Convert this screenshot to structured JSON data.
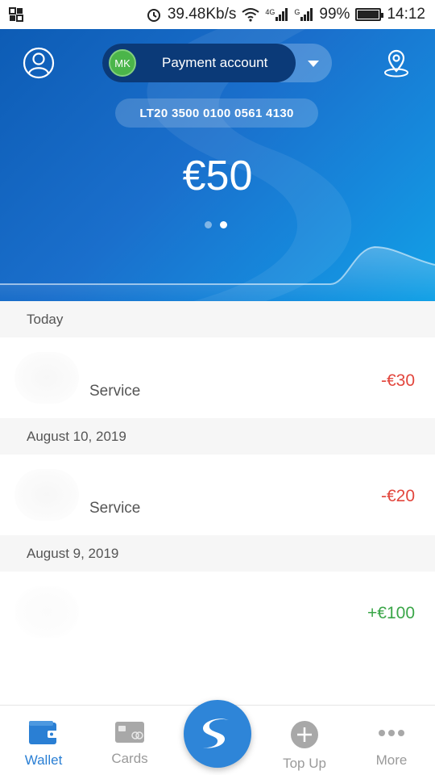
{
  "status_bar": {
    "network_speed": "39.48Kb/s",
    "signal_1": "4G",
    "signal_2": "G",
    "battery": "99%",
    "battery_level": 0.99,
    "time": "14:12"
  },
  "header": {
    "account": {
      "initials": "MK",
      "name": "Payment account"
    },
    "iban": "LT20 3500 0100 0561 4130",
    "balance": "€50",
    "page_indicator": {
      "count": 2,
      "active": 2
    }
  },
  "transactions": [
    {
      "date": "Today",
      "items": [
        {
          "name": "Service",
          "amount": "-€30",
          "type": "debit"
        }
      ]
    },
    {
      "date": "August 10, 2019",
      "items": [
        {
          "name": "Service",
          "amount": "-€20",
          "type": "debit"
        }
      ]
    },
    {
      "date": "August 9, 2019",
      "items": [
        {
          "name": "",
          "amount": "+€100",
          "type": "credit"
        }
      ]
    }
  ],
  "bottom_nav": {
    "items": [
      {
        "label": "Wallet",
        "icon": "wallet-icon",
        "active": true
      },
      {
        "label": "Cards",
        "icon": "card-icon",
        "active": false
      },
      {
        "label": "Top Up",
        "icon": "plus-icon",
        "active": false
      },
      {
        "label": "More",
        "icon": "more-dots-icon",
        "active": false
      }
    ],
    "center_button_icon": "s-logo-icon"
  },
  "colors": {
    "brand_blue": "#1a6fcc",
    "debit": "#e2463d",
    "credit": "#3aa648",
    "nav_active": "#2a7fd4"
  }
}
